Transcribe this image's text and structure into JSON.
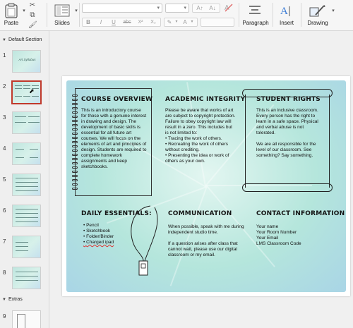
{
  "ribbon": {
    "paste_label": "Paste",
    "slides_label": "Slides",
    "paragraph_label": "Paragraph",
    "insert_label": "Insert",
    "drawing_label": "Drawing",
    "font_size_grow": "A↑",
    "font_size_shrink": "A↓",
    "bold": "B",
    "italic": "I",
    "underline": "U",
    "strikethrough": "abc",
    "superscript": "X²",
    "subscript": "X₂",
    "highlight": "✎",
    "font_color": "A"
  },
  "sidebar": {
    "sections": [
      {
        "label": "Default Section"
      },
      {
        "label": "Extras"
      }
    ],
    "slides": [
      {
        "num": "1",
        "title": "Art Syllabus"
      },
      {
        "num": "2"
      },
      {
        "num": "3"
      },
      {
        "num": "4"
      },
      {
        "num": "5"
      },
      {
        "num": "6"
      },
      {
        "num": "7"
      },
      {
        "num": "8"
      },
      {
        "num": "9"
      }
    ]
  },
  "slide": {
    "course_overview": {
      "title": "COURSE OVERVIEW",
      "text": "This is an introductory course for those with a genuine interest in drawing and design. The development of basic skills is essential for all future art courses. We will focus on the elements of art and principles of design. Students are required to complete homework assignments and keep sketchbooks."
    },
    "academic_integrity": {
      "title": "ACADEMIC INTEGRITY",
      "intro": "Please be aware that works of art are subject to copyright protection. Failure to obey copyright law will result in a zero. This includes but is not limited to:",
      "items": [
        "Tracing the work of others.",
        "Recreating the work of others without crediting.",
        "Presenting the idea or work of others as your own."
      ]
    },
    "student_rights": {
      "title": "STUDENT RIGHTS",
      "p1": "This is an inclusive classroom. Every person has the right to learn in a safe space. Physical and verbal abuse is not tolerated.",
      "p2": "We are all responsible for the level of our classroom. See something? Say something."
    },
    "daily_essentials": {
      "title": "DAILY ESSENTIALS:",
      "items": [
        "Pencil",
        "Sketchbook",
        "Folder/Binder",
        "Charged ipad"
      ]
    },
    "communication": {
      "title": "COMMUNICATION",
      "p1": "When possible, speak with me during independent studio time.",
      "p2": "If a question arises after class that cannot wait, please use our digital classroom or my email."
    },
    "contact_information": {
      "title": "CONTACT INFORMATION",
      "lines": [
        "Your name",
        "Your Room Number",
        "Your Email",
        "LMS Classroom Code"
      ]
    }
  },
  "colors": {
    "selected_thumb_border": "#c0392b",
    "slide_teal": "#b5e6dc",
    "slide_blue": "#a9d5e6"
  }
}
